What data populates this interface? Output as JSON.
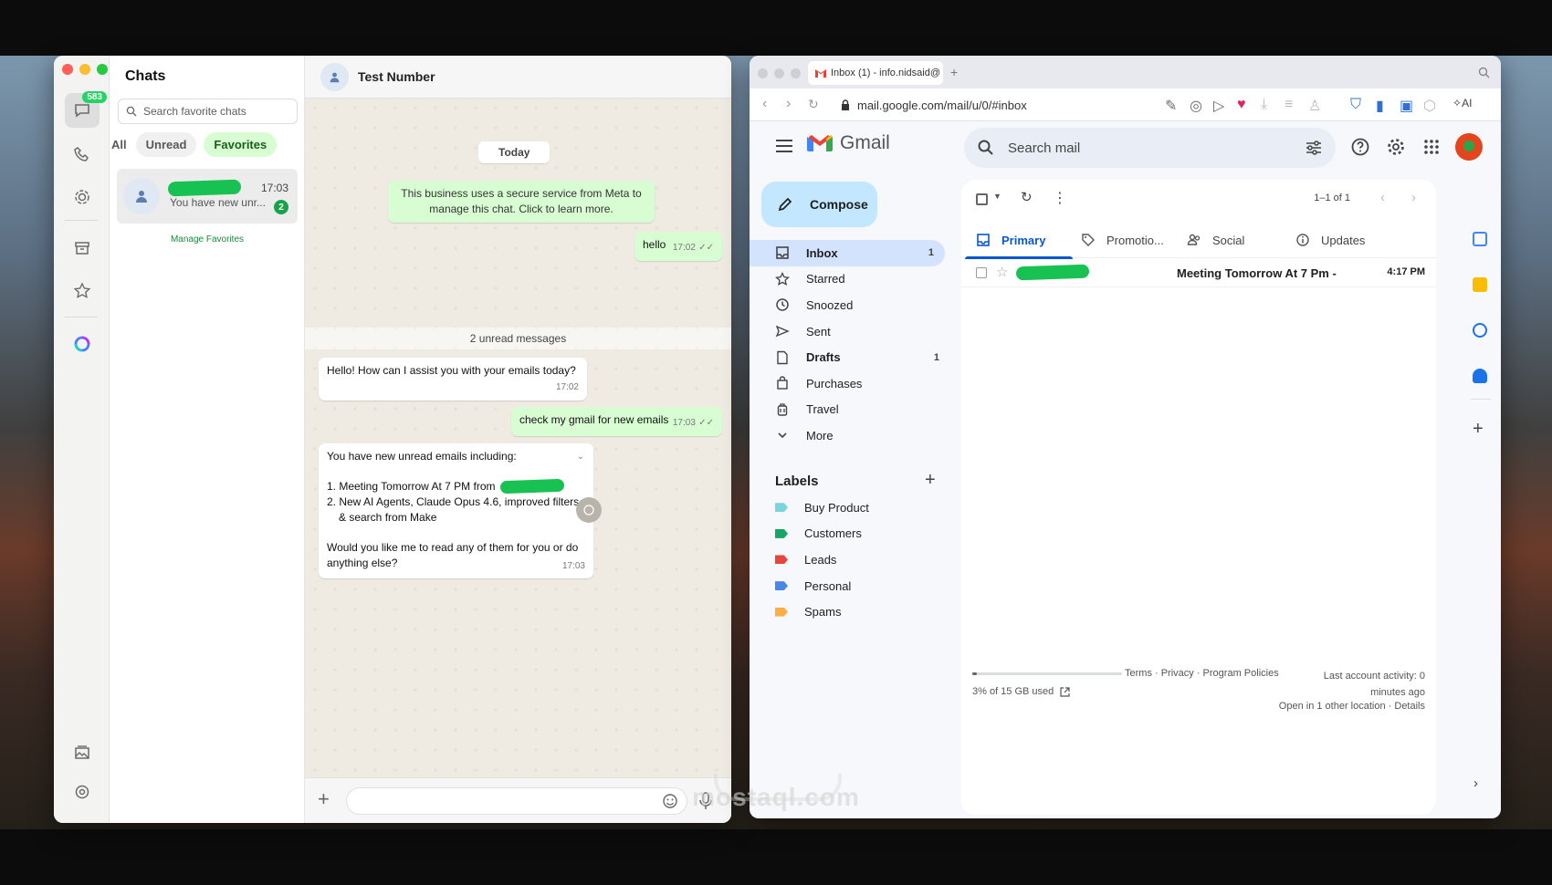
{
  "whatsapp": {
    "rail": {
      "chats_badge": "583"
    },
    "list": {
      "title": "Chats",
      "search_placeholder": "Search favorite chats",
      "filters": [
        "All",
        "Unread",
        "Favorites"
      ],
      "chat_item": {
        "time": "17:03",
        "preview": "You have new unr...",
        "badge": "2"
      },
      "manage_link": "Manage Favorites"
    },
    "chat": {
      "contact_name": "Test Number",
      "date_pill": "Today",
      "system_notice": "This business uses a secure service from Meta to manage this chat. Click to learn more.",
      "unread_divider": "2 unread messages",
      "messages": [
        {
          "dir": "out",
          "text": "hello",
          "time": "17:02"
        },
        {
          "dir": "in",
          "text": "Hello! How can I assist you with your emails today?",
          "time": "17:02"
        },
        {
          "dir": "out",
          "text": "check my gmail for new emails",
          "time": "17:03"
        },
        {
          "dir": "in",
          "intro": "You have new unread emails including:",
          "item1": "1. Meeting Tomorrow At 7 PM from",
          "item2": "2. New AI Agents, Claude Opus 4.6, improved filters & search from Make",
          "outro": "Would you like me to read any of them for you or do anything else?",
          "time": "17:03"
        }
      ]
    }
  },
  "browser": {
    "tab_title": "Inbox (1) - info.nidsaid@",
    "url": "mail.google.com/mail/u/0/#inbox",
    "ai_label": "AI"
  },
  "gmail": {
    "logo_text": "Gmail",
    "search_placeholder": "Search mail",
    "compose_label": "Compose",
    "nav": [
      {
        "label": "Inbox",
        "count": "1",
        "icon": "inbox-icon"
      },
      {
        "label": "Starred",
        "count": "",
        "icon": "star-icon"
      },
      {
        "label": "Snoozed",
        "count": "",
        "icon": "clock-icon"
      },
      {
        "label": "Sent",
        "count": "",
        "icon": "send-icon"
      },
      {
        "label": "Drafts",
        "count": "1",
        "icon": "draft-icon"
      },
      {
        "label": "Purchases",
        "count": "",
        "icon": "bag-icon"
      },
      {
        "label": "Travel",
        "count": "",
        "icon": "luggage-icon"
      },
      {
        "label": "More",
        "count": "",
        "icon": "chevron-down-icon"
      }
    ],
    "labels_heading": "Labels",
    "labels": [
      {
        "name": "Buy Product",
        "color": "#7ad3dd"
      },
      {
        "name": "Customers",
        "color": "#16a765"
      },
      {
        "name": "Leads",
        "color": "#e8453c"
      },
      {
        "name": "Personal",
        "color": "#4986e7"
      },
      {
        "name": "Spams",
        "color": "#ffad47"
      }
    ],
    "pagination": "1–1 of 1",
    "tabs": [
      "Primary",
      "Promotio...",
      "Social",
      "Updates"
    ],
    "email_row": {
      "subject": "Meeting Tomorrow At 7 Pm -",
      "time": "4:17 PM"
    },
    "footer": {
      "quota": "3% of 15 GB used",
      "quota_fraction": 0.03,
      "links": "Terms · Privacy · Program Policies",
      "activity": "Last account activity: 0 minutes ago",
      "details": "Open in 1 other location · Details"
    }
  },
  "watermark": "mostaql.com",
  "colors": {
    "wa_green": "#25d366",
    "gmail_blue": "#0b57d0",
    "compose_bg": "#c2e7ff"
  }
}
